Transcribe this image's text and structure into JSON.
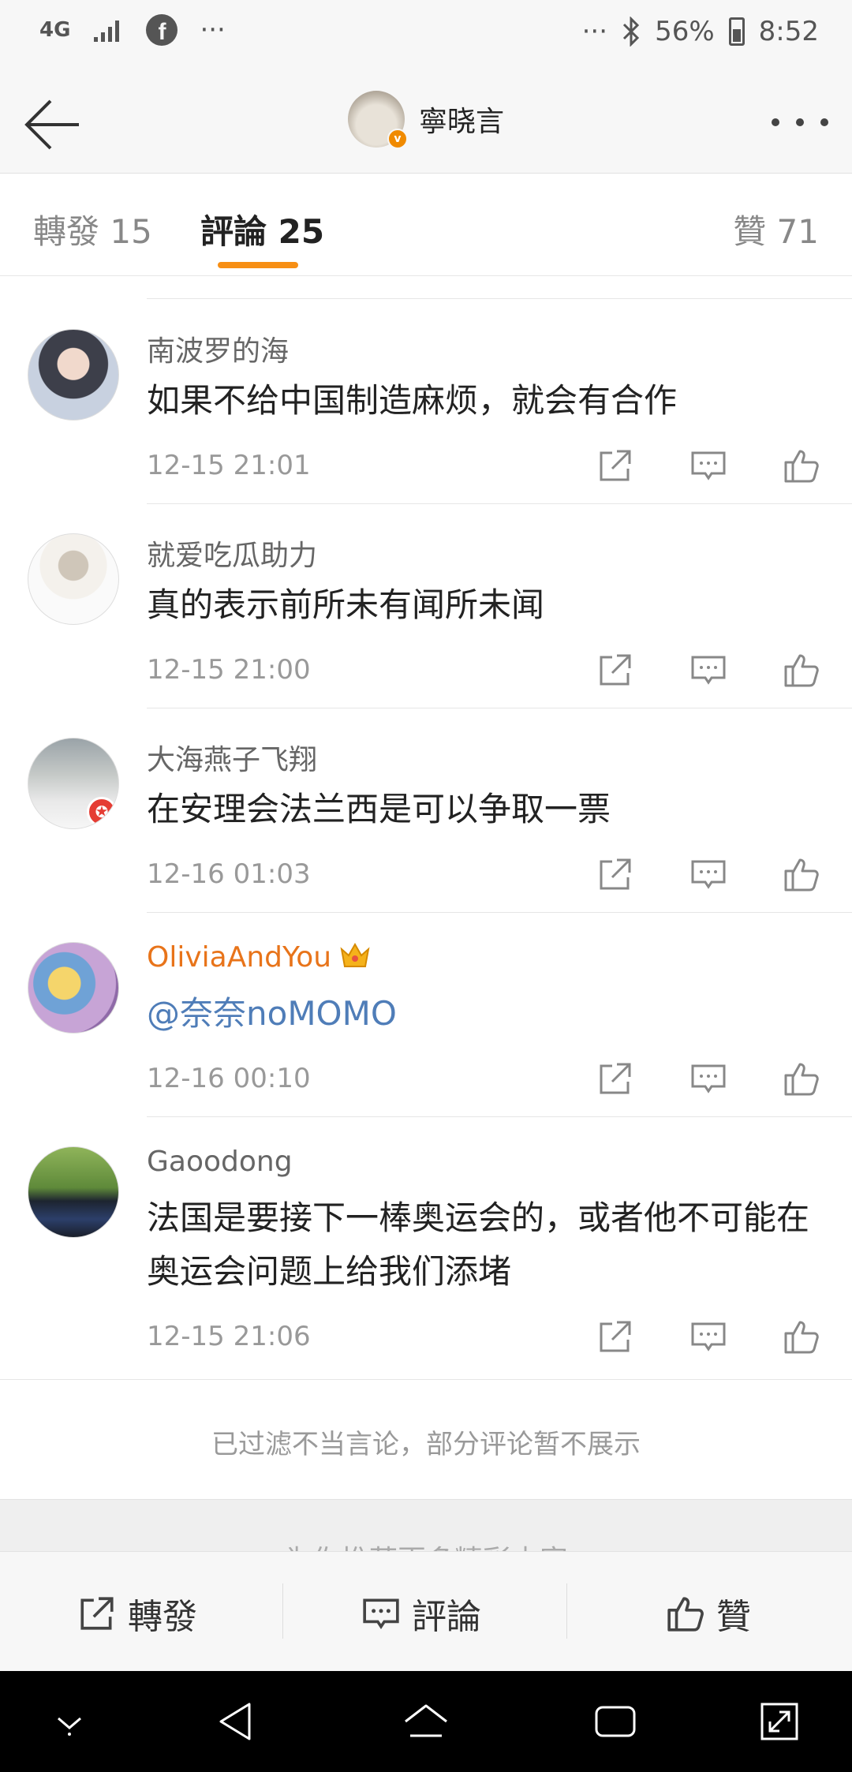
{
  "status_bar": {
    "network": "4G",
    "facebook": "f",
    "more_left": "···",
    "more_right": "···",
    "battery": "56%",
    "time": "8:52"
  },
  "header": {
    "title": "寧晓言"
  },
  "tabs": [
    {
      "label": "轉發 15"
    },
    {
      "label": "評論 25"
    },
    {
      "label": "贊 71"
    }
  ],
  "comments": [
    {
      "name": "南波罗的海",
      "text": "如果不给中国制造麻烦，就会有合作",
      "time": "12-15 21:01"
    },
    {
      "name": "就爱吃瓜助力",
      "text": "真的表示前所未有闻所未闻",
      "time": "12-15 21:00"
    },
    {
      "name": "大海燕子飞翔",
      "text": "在安理会法兰西是可以争取一票",
      "time": "12-16 01:03"
    },
    {
      "name": "OliviaAndYou",
      "text": "@奈奈noMOMO",
      "time": "12-16 00:10"
    },
    {
      "name": "Gaoodong",
      "text": "法国是要接下一棒奥运会的，或者他不可能在奥运会问题上给我们添堵",
      "time": "12-15 21:06"
    }
  ],
  "filter_note": "已过滤不当言论，部分评论暂不展示",
  "recommend_partial": "为你推荐更多精彩内容",
  "bottom_bar": {
    "repost": "轉發",
    "comment": "評論",
    "like": "贊"
  },
  "colors": {
    "accent": "#f78f14",
    "vip_name": "#e8741a",
    "mention": "#4f7db8"
  }
}
